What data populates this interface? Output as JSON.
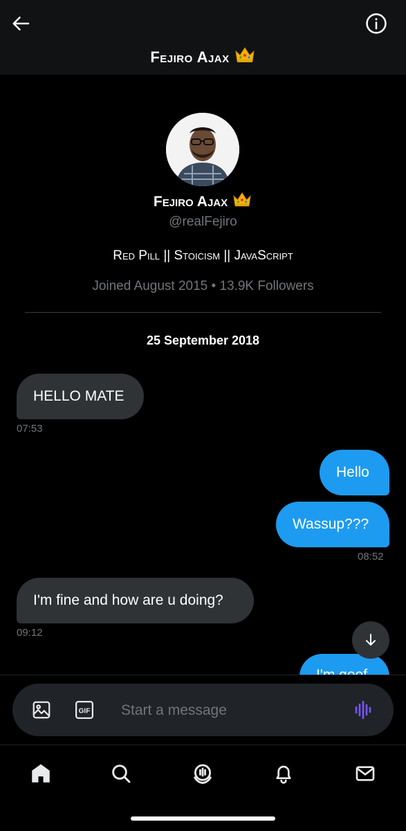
{
  "header": {
    "title": "Fejiro Ajax",
    "back_icon": "arrow-left-icon",
    "info_icon": "info-icon"
  },
  "profile": {
    "name": "Fejiro Ajax",
    "handle": "@realFejiro",
    "bio": "Red Pill || Stoicism || JavaScript",
    "joined": "Joined August 2015",
    "separator": "•",
    "followers": "13.9K Followers",
    "badge_icon": "crown-emoji"
  },
  "conversation": {
    "date": "25 September 2018",
    "messages": [
      {
        "direction": "in",
        "text": "HELLO MATE",
        "time": "07:53"
      },
      {
        "direction": "out",
        "text": "Hello"
      },
      {
        "direction": "out",
        "text": "Wassup???",
        "time": "08:52"
      },
      {
        "direction": "in",
        "text": "I'm fine and how are u doing?",
        "time": "09:12"
      },
      {
        "direction": "out",
        "text": "I'm goof"
      }
    ]
  },
  "composer": {
    "placeholder": "Start a message",
    "image_icon": "image-icon",
    "gif_label": "GIF",
    "voice_icon": "voice-waveform-icon"
  },
  "colors": {
    "accent": "#1d9bf0",
    "bubble_in": "#2f3336",
    "voice": "#7856ff",
    "muted": "#71767b"
  },
  "tabbar": [
    "home-icon",
    "search-icon",
    "spaces-icon",
    "notifications-icon",
    "messages-icon"
  ]
}
